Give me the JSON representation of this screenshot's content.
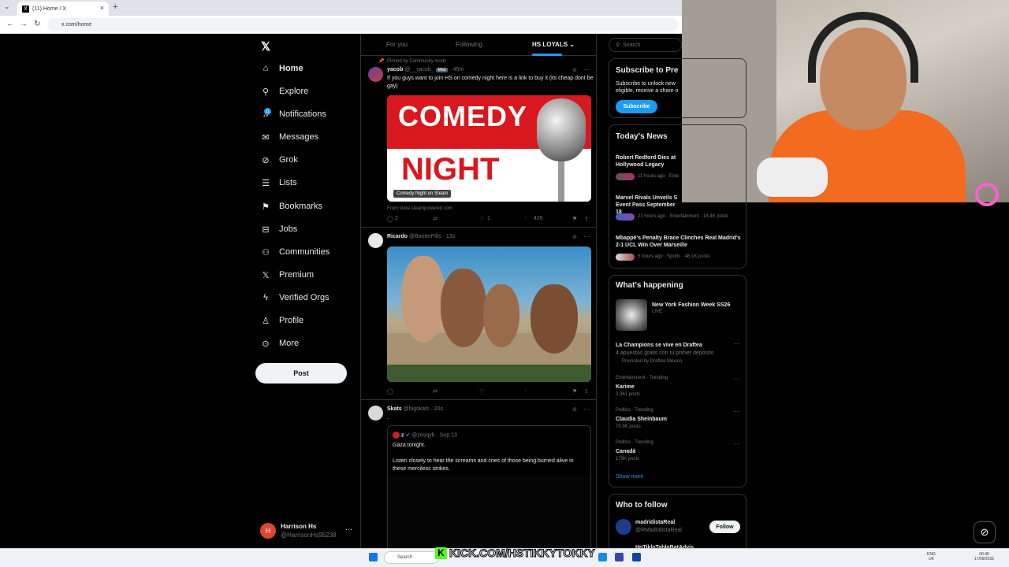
{
  "browser": {
    "tab_title": "(11) Home / X",
    "url": "x.com/home",
    "new_tab_symbol": "+",
    "close_symbol": "×"
  },
  "logo_text": "𝕏",
  "nav": {
    "items": [
      {
        "label": "Home",
        "icon": "home-icon",
        "glyph": "⌂"
      },
      {
        "label": "Explore",
        "icon": "search-icon",
        "glyph": "⚲"
      },
      {
        "label": "Notifications",
        "icon": "bell-icon",
        "glyph": "♫"
      },
      {
        "label": "Messages",
        "icon": "mail-icon",
        "glyph": "✉"
      },
      {
        "label": "Grok",
        "icon": "grok-icon",
        "glyph": "⊘"
      },
      {
        "label": "Lists",
        "icon": "list-icon",
        "glyph": "☰"
      },
      {
        "label": "Bookmarks",
        "icon": "bookmark-icon",
        "glyph": "⚑"
      },
      {
        "label": "Jobs",
        "icon": "briefcase-icon",
        "glyph": "⊟"
      },
      {
        "label": "Communities",
        "icon": "communities-icon",
        "glyph": "⚇"
      },
      {
        "label": "Premium",
        "icon": "x-icon",
        "glyph": "𝕏"
      },
      {
        "label": "Verified Orgs",
        "icon": "lightning-icon",
        "glyph": "ϟ"
      },
      {
        "label": "Profile",
        "icon": "person-icon",
        "glyph": "♙"
      },
      {
        "label": "More",
        "icon": "more-circle-icon",
        "glyph": "⊙"
      }
    ],
    "notifications_badge": "11",
    "post_button": "Post"
  },
  "account": {
    "initial": "H",
    "name": "Harrison Hs",
    "handle": "@HarrisonHs95238",
    "more": "···"
  },
  "feed": {
    "tabs": [
      "For you",
      "Following",
      "HS LOYALS ⌄"
    ],
    "pinned_label": "Pinned by Community mods",
    "tweets": [
      {
        "name": "yacob",
        "handle": "@__yacob_",
        "badge": "Mod",
        "time": "· 45m",
        "text": "If you guys want to join HS on comedy night here is a link to buy it (its cheap dont be gay)",
        "card": {
          "line1": "COMEDY",
          "line2": "NIGHT",
          "caption": "Comedy Night on Steam",
          "source": "From store.steampowered.com"
        },
        "actions": {
          "replies": "2",
          "reposts": "",
          "likes": "1",
          "views": "426"
        }
      },
      {
        "name": "Ricardo",
        "handle": "@BanterPills",
        "time": "· 13s",
        "actions": {
          "replies": "",
          "reposts": "",
          "likes": "",
          "views": ""
        }
      },
      {
        "name": "Skats",
        "handle": "@bigskats",
        "time": "· 20s",
        "text": ".",
        "quote": {
          "name": "z",
          "handle": "@zesqyb",
          "time": "· Sep 13",
          "line1": "Gaza tonight.",
          "line2": "Listen closely to hear the screams and cries of those being burned alive in these merciless strikes."
        }
      }
    ]
  },
  "right": {
    "search_placeholder": "Search",
    "subscribe": {
      "title": "Subscribe to Pre",
      "text": "Subscribe to unlock new eligible, receive a share o",
      "button": "Subscribe"
    },
    "news": {
      "title": "Today's News",
      "items": [
        {
          "headline": "Robert Redford Dies at Hollywood Legacy",
          "meta": "11 hours ago · Ente"
        },
        {
          "headline": "Marvel Rivals Unveils S Event Pass September 18",
          "meta": "21 hours ago · Entertainment · 18.4K posts"
        },
        {
          "headline": "Mbappé's Penalty Brace Clinches Real Madrid's 2-1 UCL Win Over Marseille",
          "meta": "5 hours ago · Sports · 46.1K posts"
        }
      ]
    },
    "happening": {
      "title": "What's happening",
      "featured": {
        "title": "New York Fashion Week SS26",
        "live": "LIVE"
      },
      "promo": {
        "title": "La Champions se vive en Draftea",
        "sub": "4 apuestas gratis con tu primer depósito",
        "promoted": "Promoted by Draftea México"
      },
      "trends": [
        {
          "context": "Entertainment · Trending",
          "name": "Karime",
          "posts": "2,361 posts"
        },
        {
          "context": "Politics · Trending",
          "name": "Claudia Sheinbaum",
          "posts": "70.9K posts"
        },
        {
          "context": "Politics · Trending",
          "name": "Canadá",
          "posts": "179K posts"
        }
      ],
      "show_more": "Show more"
    },
    "follow": {
      "title": "Who to follow",
      "items": [
        {
          "name": "madridistaReal",
          "handle": "@RMadridistaReal",
          "button": "Follow"
        },
        {
          "name": "HoTikloTabloBatAdvis",
          "handle": "",
          "button": "Follow"
        }
      ]
    }
  },
  "overlay": {
    "kick_letter": "K",
    "kick_text": "KICK.COM/HSTIKKYTOKKY"
  },
  "taskbar": {
    "search": "Search",
    "lang": "ENG\nUK",
    "time": "00:40",
    "date": "17/09/2025"
  },
  "colors": {
    "accent": "#1d9bf0",
    "bg": "#000000",
    "kick": "#53fc18"
  }
}
